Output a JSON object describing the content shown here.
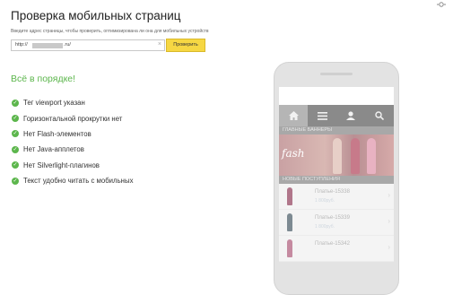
{
  "page": {
    "title": "Проверка мобильных страниц",
    "subtitle": "Введите адрес страницы, чтобы проверить, оптимизирована ли она для мобильных устройств",
    "url_prefix": "http://",
    "url_suffix": ".ru/",
    "clear_symbol": "×",
    "check_button": "Проверить",
    "result_heading": "Всё в порядке!",
    "checks": [
      "Тег viewport указан",
      "Горизонтальной прокрутки нет",
      "Нет Flash-элементов",
      "Нет Java-апплетов",
      "Нет Silverlight-плагинов",
      "Текст удобно читать с мобильных"
    ],
    "check_mark": "✓"
  },
  "phone": {
    "tabs": [
      "home-icon",
      "menu-icon",
      "user-icon",
      "search-icon"
    ],
    "banner_section": "ГЛАВНЫЕ БАННЕРЫ",
    "banner_script": "fash",
    "new_section": "НОВЫЕ ПОСТУПЛЕНИЯ",
    "products": [
      {
        "name": "Платье-15338",
        "price": "1 800руб."
      },
      {
        "name": "Платье-15339",
        "price": "1 800руб."
      },
      {
        "name": "Платье-15342",
        "price": ""
      }
    ],
    "chevron": "›"
  },
  "colors": {
    "accent_yellow": "#f6d743",
    "success_green": "#5cb64c",
    "tabbar_gray": "#8a8a8a"
  }
}
